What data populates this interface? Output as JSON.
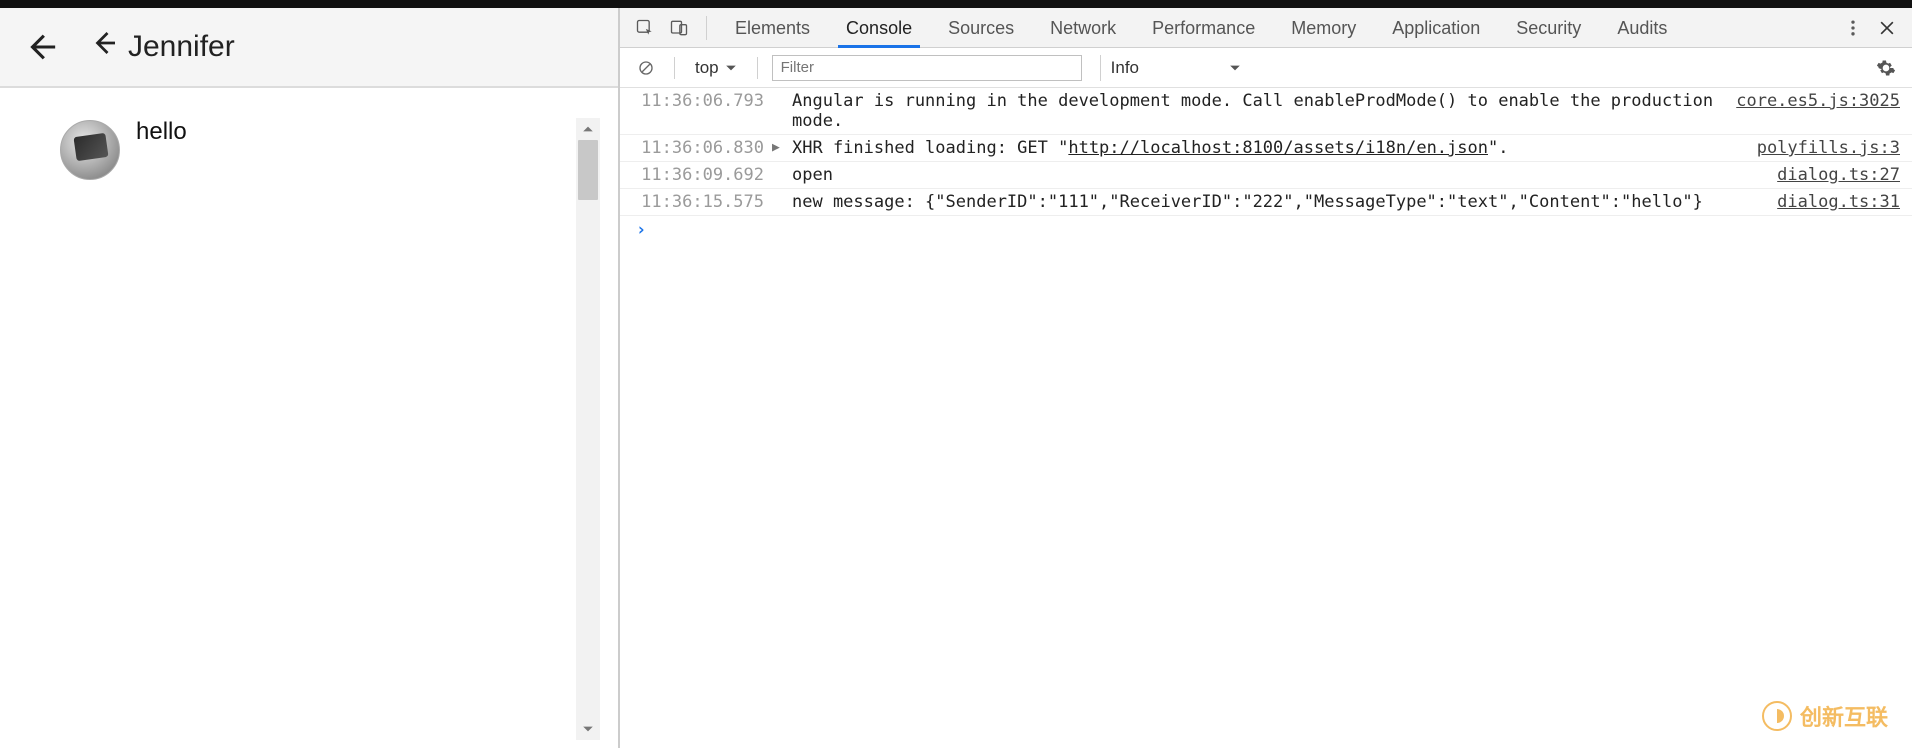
{
  "app": {
    "header_title": "Jennifer",
    "message_text": "hello"
  },
  "devtools": {
    "tabs": [
      "Elements",
      "Console",
      "Sources",
      "Network",
      "Performance",
      "Memory",
      "Application",
      "Security",
      "Audits"
    ],
    "active_tab_index": 1,
    "context_label": "top",
    "filter_placeholder": "Filter",
    "level_label": "Info"
  },
  "console": {
    "rows": [
      {
        "ts": "11:36:06.793",
        "caret": "",
        "msg_plain": "Angular is running in the development mode. Call enableProdMode() to enable the production mode.",
        "link_text": "",
        "msg_suffix": "",
        "src": "core.es5.js:3025"
      },
      {
        "ts": "11:36:06.830",
        "caret": "▶",
        "msg_plain": "XHR finished loading: GET \"",
        "link_text": "http://localhost:8100/assets/i18n/en.json",
        "msg_suffix": "\".",
        "src": "polyfills.js:3"
      },
      {
        "ts": "11:36:09.692",
        "caret": "",
        "msg_plain": "open",
        "link_text": "",
        "msg_suffix": "",
        "src": "dialog.ts:27"
      },
      {
        "ts": "11:36:15.575",
        "caret": "",
        "msg_plain": "new message: {\"SenderID\":\"111\",\"ReceiverID\":\"222\",\"MessageType\":\"text\",\"Content\":\"hello\"}",
        "link_text": "",
        "msg_suffix": "",
        "src": "dialog.ts:31"
      }
    ]
  },
  "watermark": {
    "text": "创新互联"
  }
}
